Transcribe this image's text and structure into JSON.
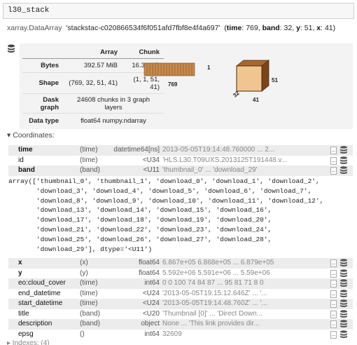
{
  "cell": {
    "input_text": "l30_stack"
  },
  "header": {
    "type": "xarray.DataArray",
    "name": "'stackstac-c020866534f6f051afd7fbf8e4f4a697'",
    "dims": [
      {
        "name": "time",
        "size": "769"
      },
      {
        "name": "band",
        "size": "32"
      },
      {
        "name": "y",
        "size": "51"
      },
      {
        "name": "x",
        "size": "41"
      }
    ]
  },
  "summary": {
    "col_array": "Array",
    "col_chunk": "Chunk",
    "rows": [
      {
        "label": "Bytes",
        "array": "392.57 MiB",
        "chunk": "16.34 kiB"
      },
      {
        "label": "Shape",
        "array": "(769, 32, 51, 41)",
        "chunk": "(1, 1, 51, 41)"
      },
      {
        "label": "Dask graph",
        "array": "24608 chunks in 3 graph layers",
        "chunk": ""
      },
      {
        "label": "Data type",
        "array": "float64 numpy.ndarray",
        "chunk": ""
      }
    ],
    "diagram": {
      "left_bar_width_label": "769",
      "left_bar_height_label": "1",
      "cube_height_label": "51",
      "cube_width_label": "41",
      "cube_depth_label": "32"
    }
  },
  "coords_header": "▾ Coordinates:",
  "coords_top": [
    {
      "name": "time",
      "bold": true,
      "dims": "(time)",
      "dtype": "datetime64[ns]",
      "preview": "2013-05-05T19:14:48.760000 ... 2..."
    },
    {
      "name": "id",
      "bold": false,
      "dims": "(time)",
      "dtype": "<U34",
      "preview": "'HLS.L30.T09UXS.2013125T191448.v..."
    },
    {
      "name": "band",
      "bold": true,
      "dims": "(band)",
      "dtype": "<U11",
      "preview": "'thumbnail_0' ... 'download_29'"
    }
  ],
  "band_array_text": "array(['thumbnail_0', 'thumbnail_1', 'download_0', 'download_1', 'download_2',\n       'download_3', 'download_4', 'download_5', 'download_6', 'download_7',\n       'download_8', 'download_9', 'download_10', 'download_11', 'download_12',\n       'download_13', 'download_14', 'download_15', 'download_16',\n       'download_17', 'download_18', 'download_19', 'download_20',\n       'download_21', 'download_22', 'download_23', 'download_24',\n       'download_25', 'download_26', 'download_27', 'download_28',\n       'download_29'], dtype='<U11')",
  "coords_bottom": [
    {
      "name": "x",
      "bold": true,
      "dims": "(x)",
      "dtype": "float64",
      "preview": "6.867e+05 6.868e+05 ... 6.879e+05"
    },
    {
      "name": "y",
      "bold": true,
      "dims": "(y)",
      "dtype": "float64",
      "preview": "5.592e+06 5.591e+06 ... 5.59e+06"
    },
    {
      "name": "eo:cloud_cover",
      "bold": false,
      "dims": "(time)",
      "dtype": "int64",
      "preview": "0 0 100 74 84 87 ... 95 81 71 8 0"
    },
    {
      "name": "end_datetime",
      "bold": false,
      "dims": "(time)",
      "dtype": "<U24",
      "preview": "'2013-05-05T19:15:12.646Z' ... '..."
    },
    {
      "name": "start_datetime",
      "bold": false,
      "dims": "(time)",
      "dtype": "<U24",
      "preview": "'2013-05-05T19:14:48.760Z' ... '..."
    },
    {
      "name": "title",
      "bold": false,
      "dims": "(band)",
      "dtype": "<U20",
      "preview": "'Thumbnail [0]' ... 'Direct Down..."
    },
    {
      "name": "description",
      "bold": false,
      "dims": "(band)",
      "dtype": "object",
      "preview": "None ... 'This link provides dir..."
    },
    {
      "name": "epsg",
      "bold": false,
      "dims": "()",
      "dtype": "int64",
      "preview": "32609"
    }
  ],
  "more_text": "▸ Indexes: (4)"
}
